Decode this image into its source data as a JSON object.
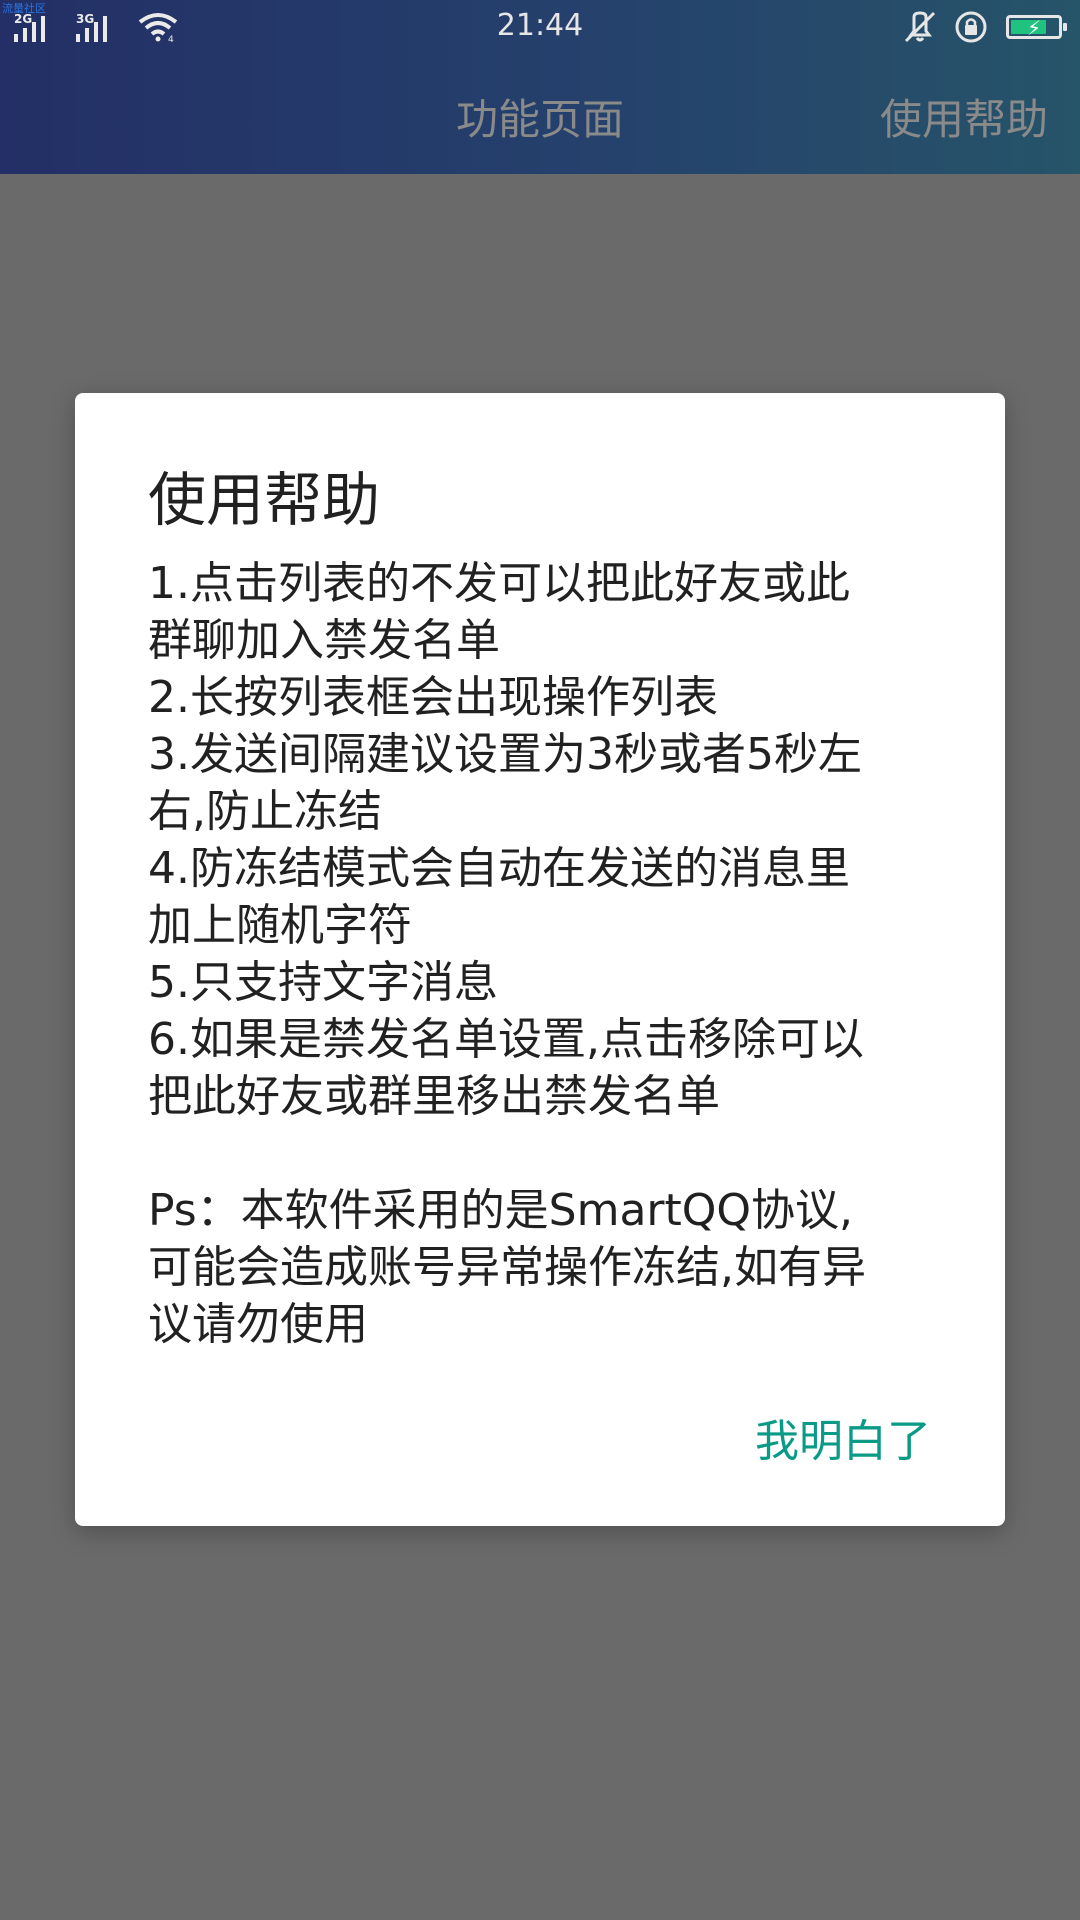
{
  "status_bar": {
    "corner_text": "流量社区",
    "network_1": "2G",
    "network_2": "3G",
    "time": "21:44"
  },
  "app_bar": {
    "tab_main": "功能页面",
    "tab_help": "使用帮助"
  },
  "dialog": {
    "title": "使用帮助",
    "lines": [
      "1.点击列表的不发可以把此好友或此",
      "群聊加入禁发名单",
      "2.长按列表框会出现操作列表",
      "3.发送间隔建议设置为3秒或者5秒左",
      "右,防止冻结",
      "4.防冻结模式会自动在发送的消息里",
      "加上随机字符",
      "5.只支持文字消息",
      "6.如果是禁发名单设置,点击移除可以",
      "把此好友或群里移出禁发名单"
    ],
    "ps_lines": [
      "Ps：本软件采用的是SmartQQ协议,",
      "可能会造成账号异常操作冻结,如有异",
      "议请勿使用"
    ],
    "confirm_label": "我明白了"
  },
  "colors": {
    "accent": "#0a9a86",
    "scrim": "#6a6a6a",
    "battery": "#1fc37f"
  },
  "icons": {
    "signal": "signal-bars-icon",
    "wifi": "wifi-icon",
    "vibrate": "vibrate-off-icon",
    "rotation_lock": "rotation-lock-icon",
    "battery": "battery-charging-icon"
  }
}
